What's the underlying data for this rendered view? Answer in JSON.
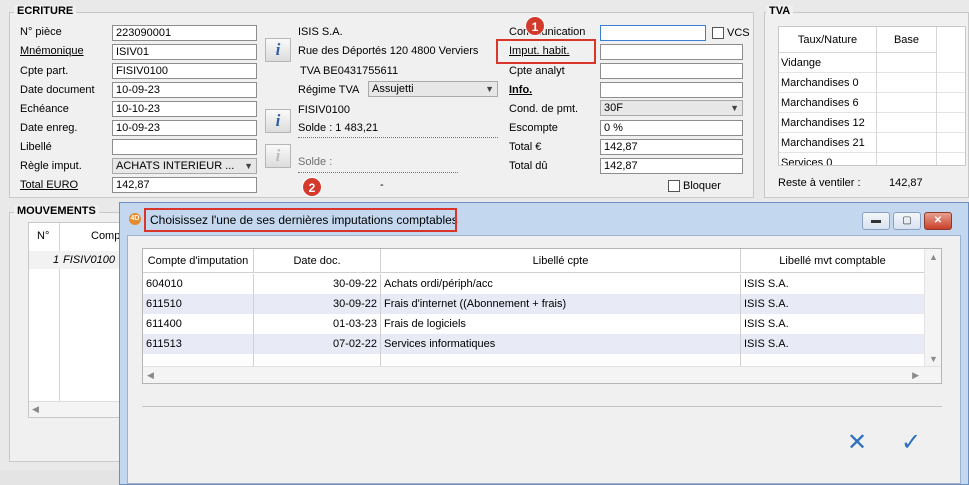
{
  "ecriture": {
    "title": "ECRITURE",
    "labels": {
      "piece": "N° pièce",
      "mnemonique": "Mnémonique",
      "cpte_part": "Cpte part.",
      "date_document": "Date document",
      "echeance": "Echéance",
      "date_enreg": "Date enreg.",
      "libelle": "Libellé",
      "regle_imput": "Règle imput.",
      "total_euro": "Total EURO"
    },
    "values": {
      "piece": "223090001",
      "mnemonique": "ISIV01",
      "cpte_part": "FISIV0100",
      "date_document": "10-09-23",
      "echeance": "10-10-23",
      "date_enreg": "10-09-23",
      "libelle": "",
      "regle_imput": "ACHATS INTERIEUR ...",
      "total_euro": "142,87"
    },
    "middle": {
      "company": "ISIS S.A.",
      "address": "Rue des Déportés 120 4800 Verviers",
      "tva": "TVA BE0431755611",
      "regime_label": "Régime TVA",
      "regime_value": "Assujetti",
      "account": "FISIV0100",
      "solde1": "Solde :  1 483,21",
      "solde2": "Solde :",
      "dash": "-"
    },
    "right": {
      "communication": "Communication",
      "imput_habit": "Imput. habit.",
      "cpte_analyt": "Cpte analyt",
      "info": "Info.",
      "cond_pmt": "Cond. de pmt.",
      "cond_pmt_value": "30F",
      "escompte": "Escompte",
      "escompte_value": "0 %",
      "total_eur": "Total €",
      "total_eur_value": "142,87",
      "total_du": "Total dû",
      "total_du_value": "142,87",
      "vcs": "VCS",
      "bloquer": "Bloquer"
    }
  },
  "tva": {
    "title": "TVA",
    "col_taux": "Taux/Nature",
    "col_base": "Base",
    "rows": [
      "Vidange",
      "Marchandises 0",
      "Marchandises 6",
      "Marchandises 12",
      "Marchandises 21",
      "Services 0"
    ],
    "reste_label": "Reste à ventiler :",
    "reste_value": "142,87"
  },
  "mouvements": {
    "title": "MOUVEMENTS",
    "col_no": "N°",
    "col_compte": "Comp",
    "row_no": "1",
    "row_compte": "FISIV0100"
  },
  "markers": {
    "m1": "1",
    "m2": "2"
  },
  "dialog": {
    "title": "Choisissez l'une de ses dernières imputations comptables",
    "columns": [
      "Compte d'imputation",
      "Date doc.",
      "Libellé cpte",
      "Libellé mvt comptable"
    ],
    "rows": [
      {
        "compte": "604010",
        "date": "30-09-22",
        "libelle": "Achats ordi/périph/acc",
        "mvt": "ISIS S.A."
      },
      {
        "compte": "611510",
        "date": "30-09-22",
        "libelle": "Frais d'internet ((Abonnement + frais)",
        "mvt": "ISIS S.A."
      },
      {
        "compte": "611400",
        "date": "01-03-23",
        "libelle": "Frais de logiciels",
        "mvt": "ISIS S.A."
      },
      {
        "compte": "611513",
        "date": "07-02-22",
        "libelle": "Services informatiques",
        "mvt": "ISIS S.A."
      }
    ]
  },
  "colors": {
    "accent": "#2f6fbf",
    "marker": "#d33a2c",
    "alt_row": "#e8eaf6"
  }
}
